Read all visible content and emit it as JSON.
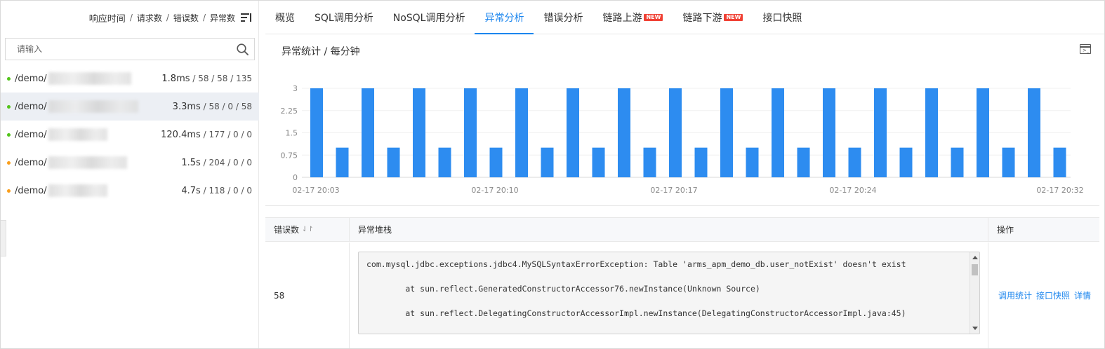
{
  "sidebar": {
    "sort_options": [
      "响应时间",
      "请求数",
      "错误数",
      "异常数"
    ],
    "search_placeholder": "请输入",
    "endpoints": [
      {
        "path": "/demo/",
        "metric_main": "1.8ms",
        "metric_rest": " / 58 / 58 / 135",
        "status_color": "#52c41a",
        "selected": false
      },
      {
        "path": "/demo/",
        "metric_main": "3.3ms",
        "metric_rest": " / 58 / 0 / 58",
        "status_color": "#52c41a",
        "selected": true
      },
      {
        "path": "/demo/",
        "metric_main": "120.4ms",
        "metric_rest": " / 177 / 0 / 0",
        "status_color": "#52c41a",
        "selected": false
      },
      {
        "path": "/demo/",
        "metric_main": "1.5s",
        "metric_rest": " / 204 / 0 / 0",
        "status_color": "#fa9e1b",
        "selected": false
      },
      {
        "path": "/demo/",
        "metric_main": "4.7s",
        "metric_rest": " / 118 / 0 / 0",
        "status_color": "#fa9e1b",
        "selected": false
      }
    ]
  },
  "tabs": [
    {
      "label": "概览",
      "badge": ""
    },
    {
      "label": "SQL调用分析",
      "badge": ""
    },
    {
      "label": "NoSQL调用分析",
      "badge": ""
    },
    {
      "label": "异常分析",
      "badge": "",
      "active": true
    },
    {
      "label": "错误分析",
      "badge": ""
    },
    {
      "label": "链路上游",
      "badge": "NEW"
    },
    {
      "label": "链路下游",
      "badge": "NEW"
    },
    {
      "label": "接口快照",
      "badge": ""
    }
  ],
  "chart_section": {
    "title": "异常统计 / 每分钟",
    "terminal_icon_glyph": ">_"
  },
  "chart_data": {
    "type": "bar",
    "bar_color": "#2d8cf0",
    "categories": [
      "02-17 20:03",
      "",
      "",
      "",
      "",
      "",
      "",
      "",
      "",
      "",
      "02-17 20:10",
      "",
      "",
      "",
      "",
      "",
      "",
      "",
      "",
      "",
      "02-17 20:17",
      "",
      "",
      "",
      "",
      "",
      "",
      "",
      "",
      "",
      "02-17 20:24",
      "",
      "",
      "",
      "",
      "",
      "",
      "",
      "",
      "",
      "",
      "",
      "02-17 20:32"
    ],
    "x_tick_labels": [
      "02-17 20:03",
      "02-17 20:10",
      "02-17 20:17",
      "02-17 20:24",
      "02-17 20:32"
    ],
    "values": [
      3,
      1,
      3,
      1,
      3,
      1,
      3,
      1,
      3,
      1,
      3,
      1,
      3,
      1,
      3,
      1,
      3,
      1,
      3,
      1,
      3,
      1,
      3,
      1,
      3,
      1,
      3,
      1,
      3,
      1
    ],
    "ylim": [
      0,
      3
    ],
    "y_ticks": [
      "0",
      "0.75",
      "1.5",
      "2.25",
      "3"
    ],
    "grid": true,
    "xlabel": "",
    "ylabel": ""
  },
  "table": {
    "headers": {
      "count": "错误数",
      "stack": "异常堆栈",
      "actions": "操作"
    },
    "rows": [
      {
        "count": "58",
        "stack_lines": [
          "com.mysql.jdbc.exceptions.jdbc4.MySQLSyntaxErrorException: Table 'arms_apm_demo_db.user_notExist' doesn't exist",
          "        at sun.reflect.GeneratedConstructorAccessor76.newInstance(Unknown Source)",
          "        at sun.reflect.DelegatingConstructorAccessorImpl.newInstance(DelegatingConstructorAccessorImpl.java:45)"
        ],
        "actions": [
          "调用统计",
          "接口快照",
          "详情"
        ]
      }
    ]
  }
}
